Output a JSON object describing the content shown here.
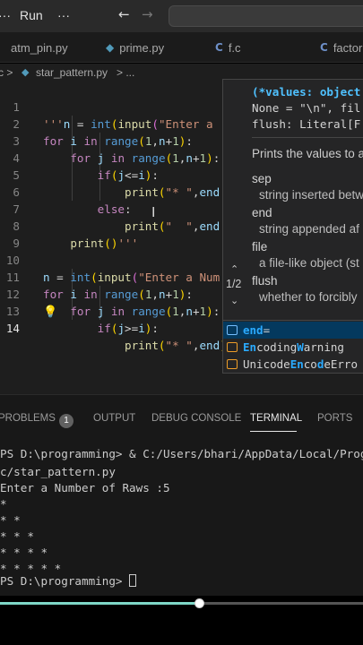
{
  "menubar": {
    "dots_label": "···",
    "run_label": "Run",
    "more_label": "···",
    "back_icon": "arrow-left-icon",
    "forward_icon": "arrow-right-icon"
  },
  "tabs": [
    {
      "icon": "python-file-icon",
      "glyph": "",
      "label": "atm_pin.py",
      "active": false
    },
    {
      "icon": "python-file-icon",
      "glyph": "◆",
      "label": "prime.py",
      "active": false
    },
    {
      "icon": "c-file-icon",
      "glyph": "C",
      "label": "f.c",
      "active": false
    },
    {
      "icon": "c-file-icon",
      "glyph": "C",
      "label": "factor",
      "active": false
    }
  ],
  "breadcrumb": {
    "prefix": "c >",
    "file": "star_pattern.py",
    "suffix": "> ..."
  },
  "editor": {
    "line_numbers": [
      "1",
      "2",
      "3",
      "4",
      "5",
      "6",
      "7",
      "8",
      "9",
      "10",
      "11",
      "12",
      "13",
      "14"
    ],
    "current_line": "14"
  },
  "signature_help": {
    "signature": [
      "(*values: object",
      "None = \"\\n\", fil",
      "flush: Literal[F"
    ],
    "description": "Prints the values to a",
    "params": [
      {
        "name": "sep",
        "desc": "string inserted betw"
      },
      {
        "name": "end",
        "desc": "string appended af"
      },
      {
        "name": "file",
        "desc": "a file-like object (st"
      },
      {
        "name": "flush",
        "desc": "whether to forcibly"
      }
    ],
    "counter": "1/2"
  },
  "suggest": {
    "items": [
      {
        "parts": [
          [
            "end",
            true
          ],
          [
            "=",
            false
          ]
        ],
        "icon": "variable-icon",
        "selected": true
      },
      {
        "parts": [
          [
            "En",
            true
          ],
          [
            "coding",
            false
          ],
          [
            "W",
            true
          ],
          [
            "arning",
            false
          ]
        ],
        "icon": "class-icon",
        "selected": false
      },
      {
        "parts": [
          [
            "Unicode",
            false
          ],
          [
            "En",
            true
          ],
          [
            "co",
            false
          ],
          [
            "d",
            true
          ],
          [
            "eErro",
            false
          ]
        ],
        "icon": "class-icon",
        "selected": false
      }
    ]
  },
  "panel": {
    "tabs": [
      "PROBLEMS",
      "OUTPUT",
      "DEBUG CONSOLE",
      "TERMINAL",
      "PORTS"
    ],
    "active_tab": "TERMINAL",
    "problems_count": "1"
  },
  "terminal": {
    "lines": [
      "PS D:\\programming> & C:/Users/bhari/AppData/Local/Progr",
      "c/star_pattern.py",
      "Enter a Number of Raws :5",
      "*",
      "* *",
      "* * *",
      "* * * *",
      "* * * * *"
    ],
    "prompt": "PS D:\\programming> "
  },
  "video": {
    "progress": 0.55
  }
}
